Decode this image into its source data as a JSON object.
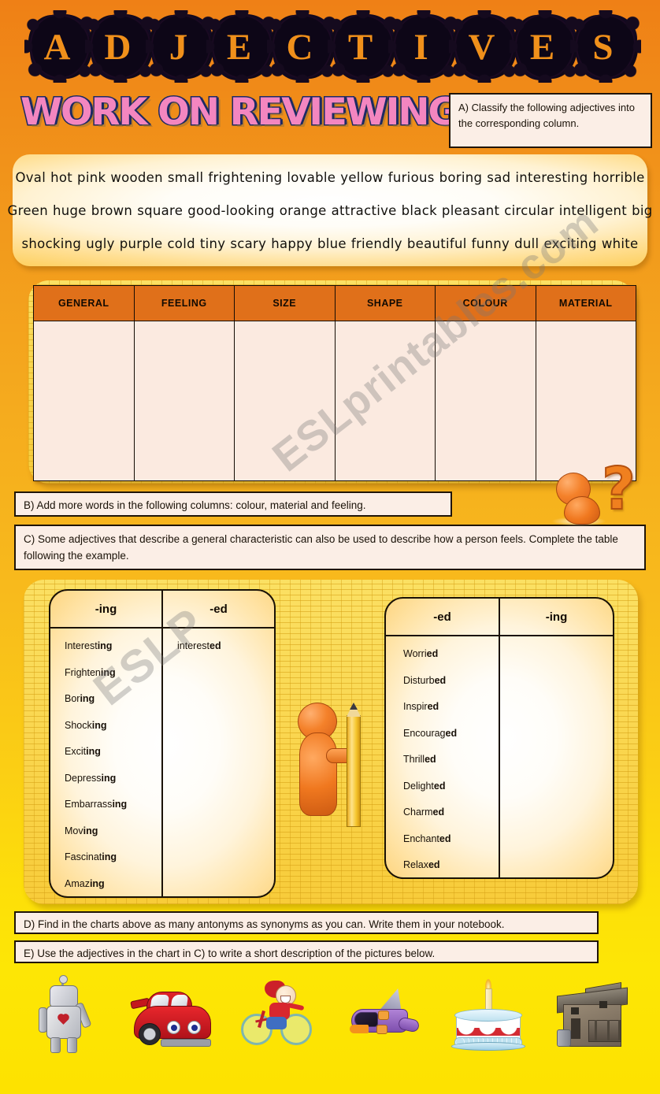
{
  "title": {
    "letters": [
      "A",
      "D",
      "J",
      "E",
      "C",
      "T",
      "I",
      "V",
      "E",
      "S"
    ],
    "text": "ADJECTIVES"
  },
  "banner": {
    "text": "WORK ON REVIEWING"
  },
  "instructions": {
    "a": "A) Classify the following adjectives into the corresponding column.",
    "b": "B) Add more words in the following columns: colour, material and feeling.",
    "c": "C) Some adjectives that describe a general characteristic can also be used to describe how a person feels. Complete the table following the example.",
    "d": "D) Find in the charts above as many antonyms as synonyms as you can. Write them in your notebook.",
    "e": "E) Use the adjectives in the chart in C) to write a short description of the pictures below."
  },
  "word_bank": {
    "line1": [
      "Oval",
      "hot",
      "pink",
      "wooden",
      "small",
      "frightening",
      "lovable",
      "yellow",
      "furious",
      "boring",
      "sad",
      "interesting",
      "horrible"
    ],
    "line2": [
      "Green",
      "huge",
      "brown",
      "square",
      "good-looking",
      "orange",
      "attractive",
      "black",
      "pleasant",
      "circular",
      "intelligent",
      "big"
    ],
    "line3": [
      "shocking",
      "ugly",
      "purple",
      "cold",
      "tiny",
      "scary",
      "happy",
      "blue",
      "friendly",
      "beautiful",
      "funny",
      "dull",
      "exciting",
      "white"
    ]
  },
  "classify_table": {
    "headers": [
      "GENERAL",
      "FEELING",
      "SIZE",
      "SHAPE",
      "COLOUR",
      "MATERIAL"
    ],
    "rows": [
      [
        "",
        "",
        "",
        "",
        "",
        ""
      ]
    ]
  },
  "chart_left": {
    "headers": [
      "-ing",
      "-ed"
    ],
    "ing_column": [
      {
        "stem": "Interest",
        "suffix": "ing"
      },
      {
        "stem": "Frighten",
        "suffix": "ing"
      },
      {
        "stem": "Bor",
        "suffix": "ing"
      },
      {
        "stem": "Shock",
        "suffix": "ing"
      },
      {
        "stem": "Excit",
        "suffix": "ing"
      },
      {
        "stem": "Depress",
        "suffix": "ing"
      },
      {
        "stem": "Embarrass",
        "suffix": "ing"
      },
      {
        "stem": "Mov",
        "suffix": "ing"
      },
      {
        "stem": "Fascinat",
        "suffix": "ing"
      },
      {
        "stem": "Amaz",
        "suffix": "ing"
      }
    ],
    "ed_column": [
      {
        "stem": "interest",
        "suffix": "ed"
      }
    ]
  },
  "chart_right": {
    "headers": [
      "-ed",
      "-ing"
    ],
    "ed_column": [
      {
        "stem": "Worri",
        "suffix": "ed"
      },
      {
        "stem": "Disturb",
        "suffix": "ed"
      },
      {
        "stem": "Inspir",
        "suffix": "ed"
      },
      {
        "stem": "Encourag",
        "suffix": "ed"
      },
      {
        "stem": "Thrill",
        "suffix": "ed"
      },
      {
        "stem": "Delight",
        "suffix": "ed"
      },
      {
        "stem": "Charm",
        "suffix": "ed"
      },
      {
        "stem": "Enchant",
        "suffix": "ed"
      },
      {
        "stem": "Relax",
        "suffix": "ed"
      }
    ],
    "ing_column": []
  },
  "pictures": [
    {
      "name": "robot"
    },
    {
      "name": "red-car"
    },
    {
      "name": "girl-on-bicycle"
    },
    {
      "name": "spaceship"
    },
    {
      "name": "birthday-cake"
    },
    {
      "name": "old-wooden-house"
    }
  ],
  "mascots": {
    "question": "?",
    "pencil": "pencil"
  },
  "watermark": {
    "main": "ESLprintables.com",
    "sub": "ESLP"
  },
  "colors": {
    "page_top": "#ef8016",
    "page_bottom": "#fde200",
    "header_orange": "#e0701a",
    "cell_cream": "#fbeae0",
    "brick_yellow": "#fbd94c",
    "banner_pink": "#f386c0",
    "banner_outline": "#1d2a63",
    "mascot_orange": "#f0801f"
  }
}
